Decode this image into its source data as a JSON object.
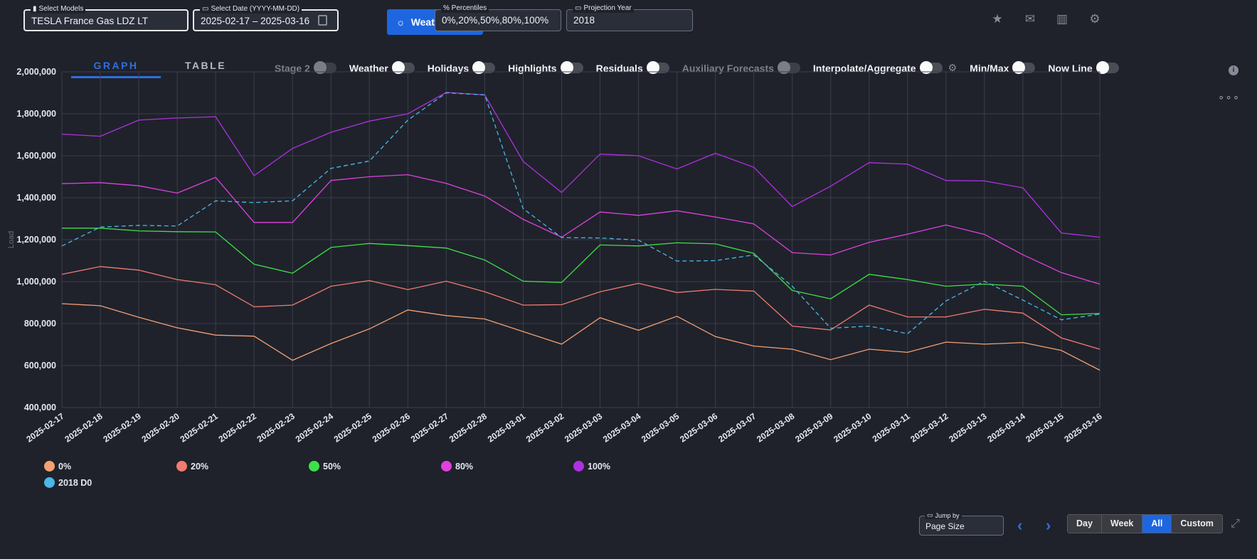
{
  "header": {
    "models": {
      "label": "Select Models",
      "value": "TESLA France Gas LDZ LT",
      "icon": "bar-chart-icon"
    },
    "date": {
      "label": "Select Date (YYYY-MM-DD)",
      "start": "2025-02-17",
      "sep": "–",
      "end": "2025-03-16",
      "icon": "calendar-icon"
    },
    "weather_risk_label": "Weather Risk",
    "percentiles": {
      "label": "% Percentiles",
      "value": "0%,20%,50%,80%,100%"
    },
    "projection_year": {
      "label": "Projection Year",
      "value": "2018",
      "icon": "calendar-icon"
    },
    "icons": [
      "star-icon",
      "mail-icon",
      "chart-icon",
      "gear-icon"
    ]
  },
  "tabs": [
    {
      "label": "GRAPH",
      "active": true
    },
    {
      "label": "TABLE",
      "active": false
    }
  ],
  "toggles": [
    {
      "label": "Stage 2",
      "on": false,
      "disabled": true
    },
    {
      "label": "Weather",
      "on": false,
      "disabled": false
    },
    {
      "label": "Holidays",
      "on": false,
      "disabled": false
    },
    {
      "label": "Highlights",
      "on": false,
      "disabled": false
    },
    {
      "label": "Residuals",
      "on": false,
      "disabled": false
    },
    {
      "label": "Auxiliary Forecasts",
      "on": false,
      "disabled": true
    },
    {
      "label": "Interpolate/Aggregate",
      "on": false,
      "disabled": false,
      "settings": true
    },
    {
      "label": "Min/Max",
      "on": false,
      "disabled": false
    },
    {
      "label": "Now Line",
      "on": false,
      "disabled": false
    }
  ],
  "footer": {
    "jump_by": {
      "label": "Jump by",
      "value": "Page Size"
    },
    "prev": "‹",
    "next": "›",
    "ranges": [
      {
        "label": "Day",
        "active": false
      },
      {
        "label": "Week",
        "active": false
      },
      {
        "label": "All",
        "active": true
      },
      {
        "label": "Custom",
        "active": false
      }
    ]
  },
  "chart_data": {
    "type": "line",
    "title": "",
    "xlabel": "",
    "ylabel": "Load",
    "ylim": [
      400000,
      2000000
    ],
    "yticks": [
      400000,
      600000,
      800000,
      1000000,
      1200000,
      1400000,
      1600000,
      1800000,
      2000000
    ],
    "grid": true,
    "legend_position": "bottom-left",
    "x": [
      "2025-02-17",
      "2025-02-18",
      "2025-02-19",
      "2025-02-20",
      "2025-02-21",
      "2025-02-22",
      "2025-02-23",
      "2025-02-24",
      "2025-02-25",
      "2025-02-26",
      "2025-02-27",
      "2025-02-28",
      "2025-03-01",
      "2025-03-02",
      "2025-03-03",
      "2025-03-04",
      "2025-03-05",
      "2025-03-06",
      "2025-03-07",
      "2025-03-08",
      "2025-03-09",
      "2025-03-10",
      "2025-03-11",
      "2025-03-12",
      "2025-03-13",
      "2025-03-14",
      "2025-03-15",
      "2025-03-16"
    ],
    "series": [
      {
        "name": "0%",
        "color": "#f4a072",
        "dashed": false,
        "values": [
          895000,
          885000,
          830000,
          780000,
          745000,
          740000,
          625000,
          705000,
          775000,
          865000,
          838000,
          822000,
          762000,
          702000,
          828000,
          768000,
          835000,
          738000,
          693000,
          678000,
          628000,
          678000,
          663000,
          712000,
          702000,
          710000,
          672000,
          578000
        ]
      },
      {
        "name": "20%",
        "color": "#f07b70",
        "dashed": false,
        "values": [
          1035000,
          1072000,
          1055000,
          1010000,
          985000,
          880000,
          888000,
          978000,
          1005000,
          962000,
          1002000,
          952000,
          888000,
          890000,
          952000,
          992000,
          948000,
          963000,
          955000,
          788000,
          770000,
          888000,
          832000,
          832000,
          868000,
          850000,
          732000,
          678000
        ]
      },
      {
        "name": "50%",
        "color": "#3ee048",
        "dashed": false,
        "values": [
          1255000,
          1255000,
          1242000,
          1238000,
          1237000,
          1083000,
          1040000,
          1163000,
          1182000,
          1172000,
          1160000,
          1103000,
          1002000,
          996000,
          1175000,
          1170000,
          1185000,
          1180000,
          1135000,
          958000,
          918000,
          1035000,
          1010000,
          978000,
          988000,
          978000,
          842000,
          848000
        ]
      },
      {
        "name": "80%",
        "color": "#e040e0",
        "dashed": false,
        "values": [
          1467000,
          1472000,
          1457000,
          1422000,
          1497000,
          1282000,
          1282000,
          1482000,
          1500000,
          1510000,
          1468000,
          1408000,
          1297000,
          1212000,
          1332000,
          1316000,
          1338000,
          1308000,
          1275000,
          1138000,
          1127000,
          1187000,
          1226000,
          1270000,
          1225000,
          1128000,
          1043000,
          988000
        ]
      },
      {
        "name": "100%",
        "color": "#b030e0",
        "dashed": false,
        "values": [
          1703000,
          1693000,
          1770000,
          1780000,
          1786000,
          1505000,
          1635000,
          1712000,
          1765000,
          1800000,
          1902000,
          1890000,
          1573000,
          1425000,
          1608000,
          1600000,
          1537000,
          1612000,
          1545000,
          1358000,
          1455000,
          1567000,
          1560000,
          1482000,
          1480000,
          1447000,
          1232000,
          1212000
        ]
      },
      {
        "name": "2018 D0",
        "color": "#4ab8e8",
        "dashed": true,
        "values": [
          1170000,
          1260000,
          1268000,
          1265000,
          1385000,
          1377000,
          1385000,
          1540000,
          1575000,
          1770000,
          1900000,
          1890000,
          1348000,
          1210000,
          1208000,
          1198000,
          1098000,
          1100000,
          1127000,
          978000,
          778000,
          788000,
          752000,
          908000,
          1002000,
          912000,
          818000,
          845000
        ]
      }
    ]
  }
}
